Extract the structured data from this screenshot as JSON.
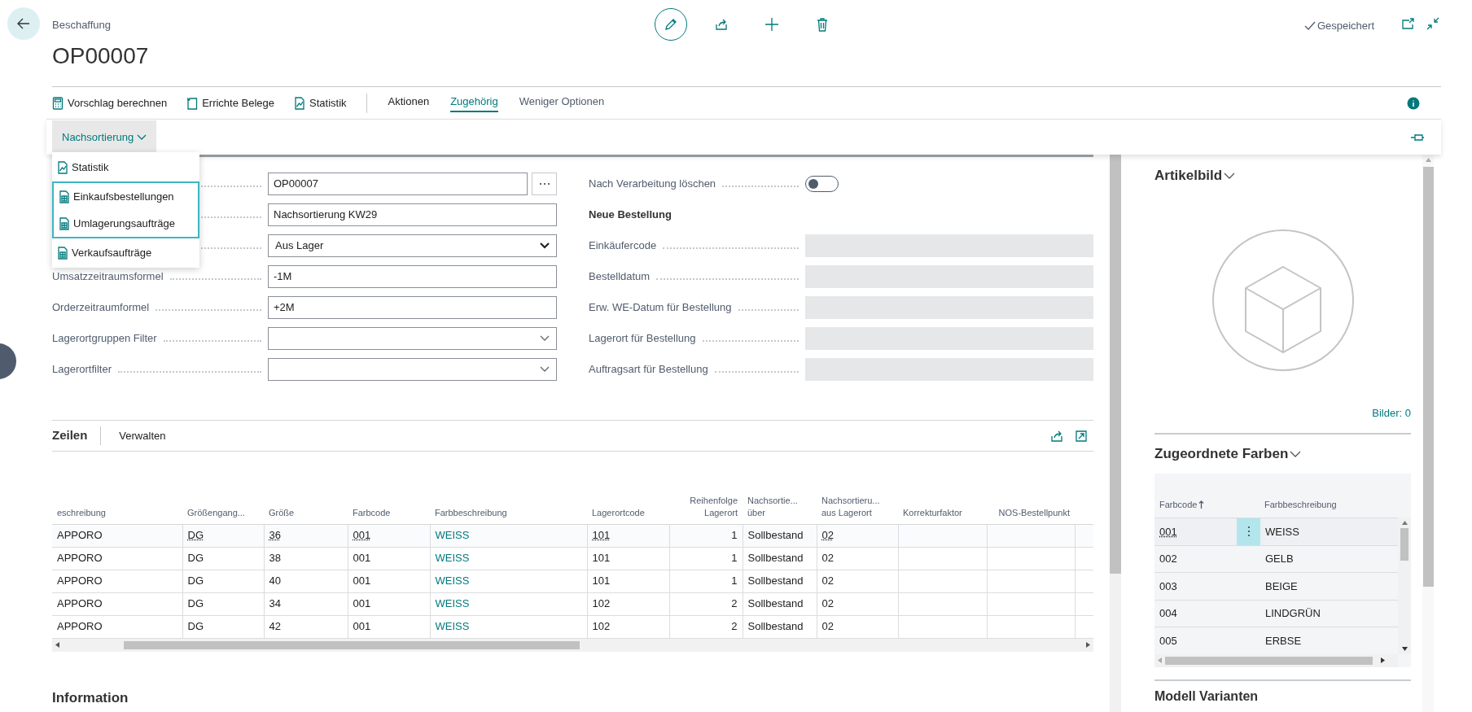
{
  "header": {
    "breadcrumb": "Beschaffung",
    "title": "OP00007",
    "status": "Gespeichert"
  },
  "action_buttons": [
    {
      "label": "Vorschlag berechnen",
      "kind": "calculator"
    },
    {
      "label": "Errichte Belege",
      "kind": "document"
    },
    {
      "label": "Statistik",
      "kind": "chart"
    }
  ],
  "menu_tabs": [
    {
      "label": "Aktionen",
      "selected": false
    },
    {
      "label": "Zugehörig",
      "selected": true
    },
    {
      "label": "Weniger Optionen",
      "selected": false
    }
  ],
  "sub_bar": {
    "button": "Nachsortierung"
  },
  "dropdown": [
    {
      "label": "Statistik",
      "kind": "chart",
      "highlighted": false
    },
    {
      "label": "Einkaufsbestellungen",
      "kind": "list",
      "highlighted": true
    },
    {
      "label": "Umlagerungsaufträge",
      "kind": "list",
      "highlighted": true
    },
    {
      "label": "Verkaufsaufträge",
      "kind": "list",
      "highlighted": false
    }
  ],
  "form_left": [
    {
      "kind": "lookup",
      "value": "OP00007"
    },
    {
      "kind": "text",
      "value": "Nachsortierung KW29"
    },
    {
      "kind": "select",
      "value": "Aus Lager"
    },
    {
      "kind": "text",
      "label": "Umsatzzeitraumsformel",
      "value": "-1M"
    },
    {
      "kind": "text",
      "label": "Orderzeitraumformel",
      "value": "+2M"
    },
    {
      "kind": "dropdown",
      "label": "Lagerortgruppen Filter"
    },
    {
      "kind": "dropdown",
      "label": "Lagerortfilter"
    }
  ],
  "form_right": [
    {
      "kind": "toggle",
      "label": "Nach Verarbeitung löschen",
      "on": false
    },
    {
      "kind": "heading",
      "label": "Neue Bestellung"
    },
    {
      "kind": "readonly",
      "label": "Einkäufercode"
    },
    {
      "kind": "readonly",
      "label": "Bestelldatum"
    },
    {
      "kind": "readonly",
      "label": "Erw. WE-Datum für Bestellung"
    },
    {
      "kind": "readonly",
      "label": "Lagerort für Bestellung"
    },
    {
      "kind": "readonly",
      "label": "Auftragsart für Bestellung"
    }
  ],
  "lines": {
    "title": "Zeilen",
    "manage": "Verwalten",
    "columns": [
      {
        "label": "eschreibung",
        "kind": "text"
      },
      {
        "label": "Größengang...",
        "kind": "code"
      },
      {
        "label": "Größe",
        "kind": "code"
      },
      {
        "label": "Farbcode",
        "kind": "code"
      },
      {
        "label": "Farbbeschreibung",
        "kind": "link"
      },
      {
        "label": "Lagerortcode",
        "kind": "code"
      },
      {
        "label": "Reihenfolge Lagerort",
        "kind": "number"
      },
      {
        "label": "Nachsortie... über",
        "kind": "text"
      },
      {
        "label": "Nachsortieru... aus Lagerort",
        "kind": "code"
      },
      {
        "label": "Korrekturfaktor",
        "kind": "text"
      },
      {
        "label": "NOS-Bestellpunkt",
        "kind": "number"
      }
    ],
    "rows": [
      {
        "focused": true,
        "cells": [
          "APPORO",
          "DG",
          "36",
          "001",
          "WEISS",
          "101",
          "1",
          "Sollbestand",
          "02",
          "",
          ""
        ]
      },
      {
        "focused": false,
        "cells": [
          "APPORO",
          "DG",
          "38",
          "001",
          "WEISS",
          "101",
          "1",
          "Sollbestand",
          "02",
          "",
          ""
        ]
      },
      {
        "focused": false,
        "cells": [
          "APPORO",
          "DG",
          "40",
          "001",
          "WEISS",
          "101",
          "1",
          "Sollbestand",
          "02",
          "",
          ""
        ]
      },
      {
        "focused": false,
        "cells": [
          "APPORO",
          "DG",
          "34",
          "001",
          "WEISS",
          "102",
          "2",
          "Sollbestand",
          "02",
          "",
          ""
        ]
      },
      {
        "focused": false,
        "cells": [
          "APPORO",
          "DG",
          "42",
          "001",
          "WEISS",
          "102",
          "2",
          "Sollbestand",
          "02",
          "",
          ""
        ]
      }
    ]
  },
  "information": {
    "title": "Information"
  },
  "picture_panel": {
    "title": "Artikelbild",
    "count": "Bilder: 0"
  },
  "colors": {
    "title": "Zugeordnete Farben",
    "columns": [
      "Farbcode",
      "Farbbeschreibung"
    ],
    "rows": [
      {
        "code": "001",
        "name": "WEISS",
        "selected": true
      },
      {
        "code": "002",
        "name": "GELB",
        "selected": false
      },
      {
        "code": "003",
        "name": "BEIGE",
        "selected": false
      },
      {
        "code": "004",
        "name": "LINDGRÜN",
        "selected": false
      },
      {
        "code": "005",
        "name": "ERBSE",
        "selected": false
      }
    ]
  },
  "next_section": {
    "title": "Modell Varianten"
  }
}
